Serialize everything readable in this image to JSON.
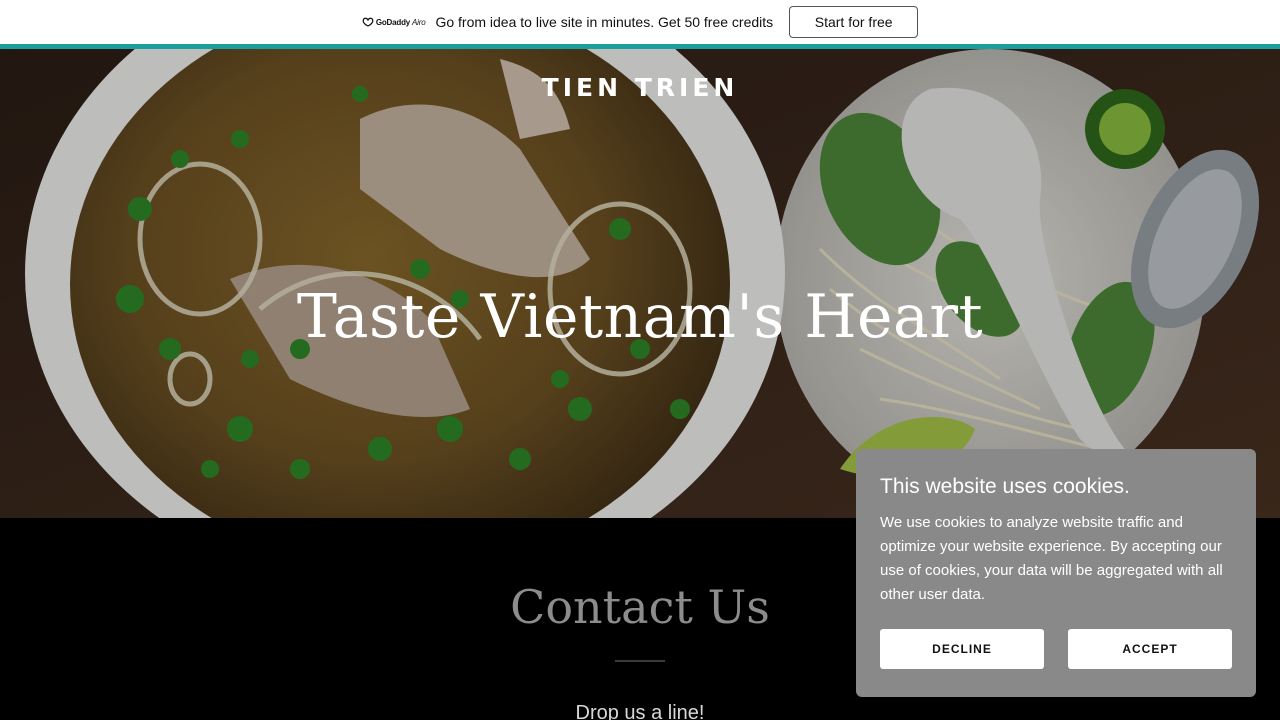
{
  "promo": {
    "logo_brand": "GoDaddy",
    "logo_product": "Airo",
    "text": "Go from idea to live site in minutes. Get 50 free credits",
    "button_label": "Start for free",
    "accent_color": "#1a9e9e"
  },
  "hero": {
    "site_name": "TIEN TRIEN",
    "title": "Taste Vietnam's Heart"
  },
  "contact": {
    "title": "Contact Us",
    "subtitle": "Drop us a line!"
  },
  "cookie_banner": {
    "title": "This website uses cookies.",
    "body": "We use cookies to analyze website traffic and optimize your website experience. By accepting our use of cookies, your data will be aggregated with all other user data.",
    "decline_label": "DECLINE",
    "accept_label": "ACCEPT",
    "background_color": "#898989"
  }
}
